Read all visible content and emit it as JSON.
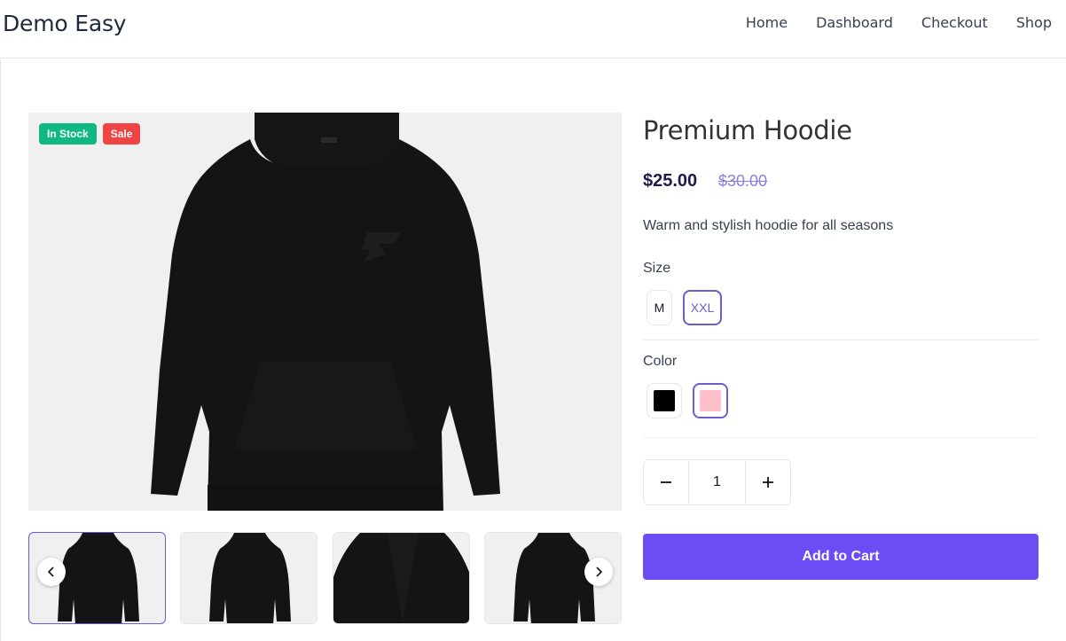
{
  "header": {
    "brand": "Demo Easy",
    "nav": [
      "Home",
      "Dashboard",
      "Checkout",
      "Shop"
    ]
  },
  "gallery": {
    "badges": {
      "stock": "In Stock",
      "sale": "Sale"
    },
    "main_image_icon": "hoodie-image",
    "thumbnails": [
      "hoodie-front",
      "hoodie-back",
      "hoodie-hood-detail",
      "hoodie-front"
    ],
    "active_thumbnail": 0,
    "prev_icon": "chevron-left-icon",
    "next_icon": "chevron-right-icon"
  },
  "product": {
    "title": "Premium Hoodie",
    "price": "$25.00",
    "old_price": "$30.00",
    "description": "Warm and stylish hoodie for all seasons",
    "size_label": "Size",
    "sizes": [
      "M",
      "XXL"
    ],
    "selected_size": "XXL",
    "color_label": "Color",
    "colors": [
      "#000000",
      "#ffc0cb"
    ],
    "selected_color": "#ffc0cb",
    "quantity": "1",
    "add_to_cart": "Add to Cart"
  },
  "colors": {
    "accent": "#6c4df5",
    "in_stock": "#10b981",
    "sale": "#ef4444"
  }
}
